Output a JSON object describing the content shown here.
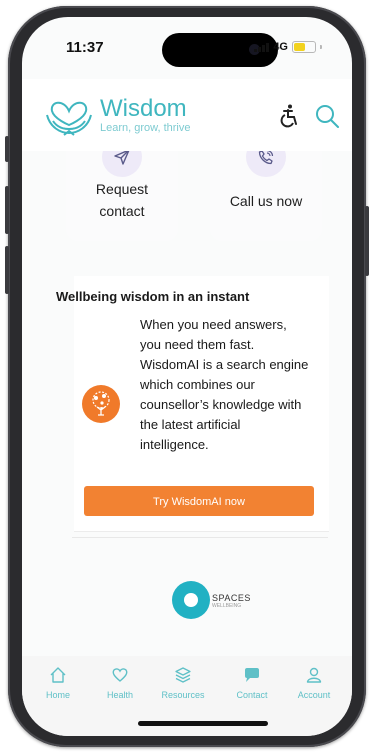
{
  "status_bar": {
    "time": "11:37",
    "network": "4G",
    "battery_level": 0.6
  },
  "header": {
    "brand_name": "Wisdom",
    "tagline": "Learn, grow, thrive"
  },
  "quick_actions": [
    {
      "label_line1": "Request",
      "label_line2": "contact",
      "icon": "paper-plane-icon"
    },
    {
      "label": "Call us now",
      "icon": "phone-call-icon"
    }
  ],
  "wisdom_ai": {
    "title": "Wellbeing wisdom in an instant",
    "lines": [
      "When you need answers,",
      "you need them fast.",
      "WisdomAI is a search engine",
      "which combines our",
      "counsellor’s knowledge with",
      "the latest artificial",
      "intelligence."
    ],
    "button_label": "Try WisdomAI now"
  },
  "partner": {
    "name": "SPACES",
    "sub": "WELLBEING"
  },
  "tabbar": [
    {
      "label": "Home",
      "icon": "home-icon",
      "active": false
    },
    {
      "label": "Health",
      "icon": "heart-icon",
      "active": false
    },
    {
      "label": "Resources",
      "icon": "resources-icon",
      "active": false
    },
    {
      "label": "Contact",
      "icon": "chat-icon",
      "active": true
    },
    {
      "label": "Account",
      "icon": "user-icon",
      "active": false
    }
  ],
  "colors": {
    "brand": "#3fb6bf",
    "accent": "#f28232",
    "partner": "#21b1c3"
  }
}
